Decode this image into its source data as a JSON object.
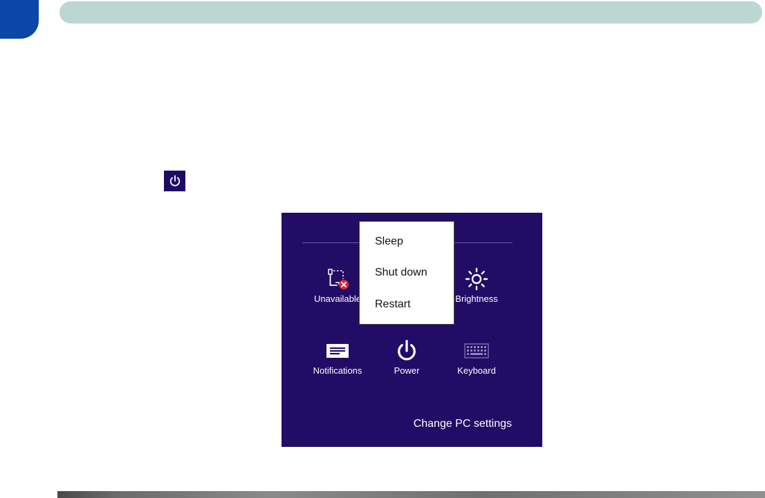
{
  "charms": {
    "tiles": {
      "unavailable": "Unavailable",
      "brightness": "Brightness",
      "notifications": "Notifications",
      "power": "Power",
      "keyboard": "Keyboard"
    },
    "change_settings": "Change PC settings"
  },
  "power_menu": {
    "items": [
      "Sleep",
      "Shut down",
      "Restart"
    ]
  },
  "icons": {
    "inline": "power-icon",
    "unavailable": "network-unavailable-icon",
    "brightness": "brightness-icon",
    "notifications": "notifications-icon",
    "power": "power-icon",
    "keyboard": "keyboard-icon"
  },
  "colors": {
    "panel": "#220c66",
    "header": "#bcd6d2",
    "chapter_tab": "#0a47a6",
    "error_red": "#e0263c"
  }
}
